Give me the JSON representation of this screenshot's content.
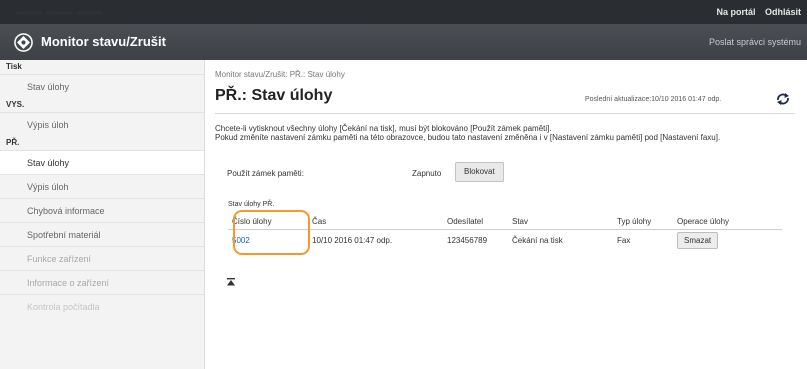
{
  "topbar": {
    "blurred_text": "——— ——— ———",
    "portal_link": "Na portál",
    "logout_link": "Odhlásit"
  },
  "header": {
    "title": "Monitor stavu/Zrušit",
    "admin_link": "Poslat správci systému"
  },
  "sidebar": {
    "groups": [
      {
        "label": "Tisk",
        "items": [
          {
            "label": "Stav úlohy"
          }
        ]
      },
      {
        "label": "VYS.",
        "items": [
          {
            "label": "Výpis úloh"
          }
        ]
      },
      {
        "label": "PŘ.",
        "items": [
          {
            "label": "Stav úlohy"
          },
          {
            "label": "Výpis úloh"
          },
          {
            "label": "Chybová informace"
          },
          {
            "label": "Spotřební materiál"
          },
          {
            "label": "Funkce zařízení"
          },
          {
            "label": "Informace o zařízení"
          },
          {
            "label": "Kontrola počítadla"
          }
        ]
      }
    ]
  },
  "main": {
    "breadcrumb": "Monitor stavu/Zrušit: PŘ.: Stav úlohy",
    "page_title": "PŘ.: Stav úlohy",
    "last_update": "Poslední aktualizace:10/10 2016 01:47 odp.",
    "info_text_1": "Chcete-li vytisknout všechny úlohy [Čekání na tisk], musí být blokováno [Použít zámek paměti].",
    "info_text_2": "Pokud změníte nastavení zámku paměti na této obrazovce, budou tato nastavení změněna i v [Nastavení zámku paměti] pod [Nastavení faxu].",
    "lock_label": "Použít zámek paměti:",
    "lock_status": "Zapnuto",
    "lock_button": "Blokovat",
    "list_title": "Stav úlohy PŘ.",
    "table": {
      "headers": [
        "Číslo úlohy",
        "Čas",
        "Odesílatel",
        "Stav",
        "Typ úlohy",
        "Operace úlohy"
      ],
      "rows": [
        {
          "job_number": "5002",
          "time": "10/10 2016 01:47 odp.",
          "sender": "123456789",
          "status": "Čekání na tisk",
          "job_type": "Fax",
          "action": "Smazat"
        }
      ]
    }
  },
  "colors": {
    "topbar_bg": "#2a2d31",
    "titlebar_bg": "#44484d",
    "sidebar_bg": "#f3f3f3",
    "link": "#1a5fb4",
    "highlight": "#f29a2e"
  }
}
